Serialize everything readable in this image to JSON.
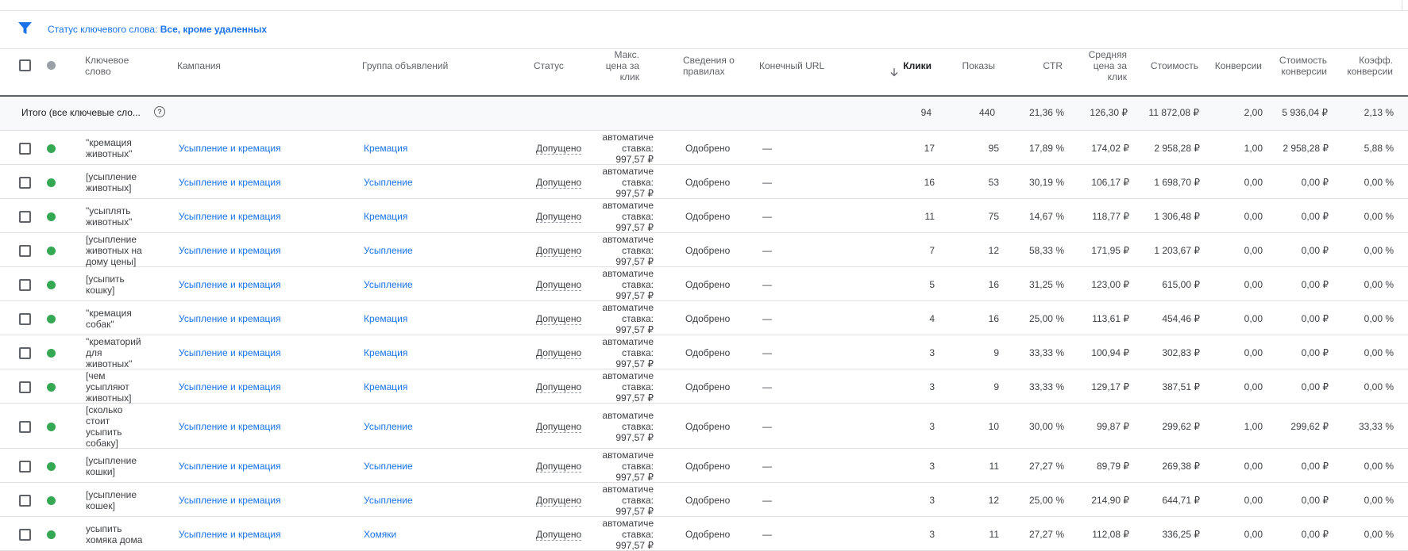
{
  "filter": {
    "label": "Статус ключевого слова: ",
    "value": "Все, кроме удаленных"
  },
  "columns": {
    "keyword": [
      "Ключевое",
      "слово"
    ],
    "campaign": "Кампания",
    "adgroup": "Группа объявлений",
    "status": "Статус",
    "maxcpc": [
      "Макс.",
      "цена за",
      "клик"
    ],
    "policy": [
      "Сведения о",
      "правилах"
    ],
    "final_url": "Конечный URL",
    "clicks": "Клики",
    "impressions": "Показы",
    "ctr": "CTR",
    "avgcpc": [
      "Средняя",
      "цена за",
      "клик"
    ],
    "cost": "Стоимость",
    "conversions": "Конверсии",
    "cost_conv": [
      "Стоимость",
      "конверсии"
    ],
    "conv_rate": [
      "Коэфф.",
      "конверсии"
    ]
  },
  "total": {
    "label": "Итого (все ключевые сло...",
    "help": "?",
    "clicks": "94",
    "impressions": "440",
    "ctr": "21,36 %",
    "avgcpc": "126,30 ₽",
    "cost": "11 872,08 ₽",
    "conversions": "2,00",
    "cost_conv": "5 936,04 ₽",
    "conv_rate": "2,13 %"
  },
  "rows": [
    {
      "keyword": [
        "\"кремация",
        "животных\""
      ],
      "campaign": "Усыпление и кремация",
      "adgroup": "Кремация",
      "status": "Допущено",
      "bid": [
        "автоматиче",
        "ставка:",
        "997,57 ₽"
      ],
      "policy": "Одобрено",
      "url": "—",
      "clicks": "17",
      "impressions": "95",
      "ctr": "17,89 %",
      "avgcpc": "174,02 ₽",
      "cost": "2 958,28 ₽",
      "conversions": "1,00",
      "cost_conv": "2 958,28 ₽",
      "conv_rate": "5,88 %"
    },
    {
      "keyword": [
        "[усыпление",
        "животных]"
      ],
      "campaign": "Усыпление и кремация",
      "adgroup": "Усыпление",
      "status": "Допущено",
      "bid": [
        "автоматиче",
        "ставка:",
        "997,57 ₽"
      ],
      "policy": "Одобрено",
      "url": "—",
      "clicks": "16",
      "impressions": "53",
      "ctr": "30,19 %",
      "avgcpc": "106,17 ₽",
      "cost": "1 698,70 ₽",
      "conversions": "0,00",
      "cost_conv": "0,00 ₽",
      "conv_rate": "0,00 %"
    },
    {
      "keyword": [
        "\"усыплять",
        "животных\""
      ],
      "campaign": "Усыпление и кремация",
      "adgroup": "Кремация",
      "status": "Допущено",
      "bid": [
        "автоматиче",
        "ставка:",
        "997,57 ₽"
      ],
      "policy": "Одобрено",
      "url": "—",
      "clicks": "11",
      "impressions": "75",
      "ctr": "14,67 %",
      "avgcpc": "118,77 ₽",
      "cost": "1 306,48 ₽",
      "conversions": "0,00",
      "cost_conv": "0,00 ₽",
      "conv_rate": "0,00 %"
    },
    {
      "keyword": [
        "[усыпление",
        "животных на",
        "дому цены]"
      ],
      "campaign": "Усыпление и кремация",
      "adgroup": "Усыпление",
      "status": "Допущено",
      "bid": [
        "автоматиче",
        "ставка:",
        "997,57 ₽"
      ],
      "policy": "Одобрено",
      "url": "—",
      "clicks": "7",
      "impressions": "12",
      "ctr": "58,33 %",
      "avgcpc": "171,95 ₽",
      "cost": "1 203,67 ₽",
      "conversions": "0,00",
      "cost_conv": "0,00 ₽",
      "conv_rate": "0,00 %"
    },
    {
      "keyword": [
        "[усыпить",
        "кошку]"
      ],
      "campaign": "Усыпление и кремация",
      "adgroup": "Усыпление",
      "status": "Допущено",
      "bid": [
        "автоматиче",
        "ставка:",
        "997,57 ₽"
      ],
      "policy": "Одобрено",
      "url": "—",
      "clicks": "5",
      "impressions": "16",
      "ctr": "31,25 %",
      "avgcpc": "123,00 ₽",
      "cost": "615,00 ₽",
      "conversions": "0,00",
      "cost_conv": "0,00 ₽",
      "conv_rate": "0,00 %"
    },
    {
      "keyword": [
        "\"кремация",
        "собак\""
      ],
      "campaign": "Усыпление и кремация",
      "adgroup": "Кремация",
      "status": "Допущено",
      "bid": [
        "автоматиче",
        "ставка:",
        "997,57 ₽"
      ],
      "policy": "Одобрено",
      "url": "—",
      "clicks": "4",
      "impressions": "16",
      "ctr": "25,00 %",
      "avgcpc": "113,61 ₽",
      "cost": "454,46 ₽",
      "conversions": "0,00",
      "cost_conv": "0,00 ₽",
      "conv_rate": "0,00 %"
    },
    {
      "keyword": [
        "\"крематорий",
        "для",
        "животных\""
      ],
      "campaign": "Усыпление и кремация",
      "adgroup": "Кремация",
      "status": "Допущено",
      "bid": [
        "автоматиче",
        "ставка:",
        "997,57 ₽"
      ],
      "policy": "Одобрено",
      "url": "—",
      "clicks": "3",
      "impressions": "9",
      "ctr": "33,33 %",
      "avgcpc": "100,94 ₽",
      "cost": "302,83 ₽",
      "conversions": "0,00",
      "cost_conv": "0,00 ₽",
      "conv_rate": "0,00 %"
    },
    {
      "keyword": [
        "[чем",
        "усыпляют",
        "животных]"
      ],
      "campaign": "Усыпление и кремация",
      "adgroup": "Кремация",
      "status": "Допущено",
      "bid": [
        "автоматиче",
        "ставка:",
        "997,57 ₽"
      ],
      "policy": "Одобрено",
      "url": "—",
      "clicks": "3",
      "impressions": "9",
      "ctr": "33,33 %",
      "avgcpc": "129,17 ₽",
      "cost": "387,51 ₽",
      "conversions": "0,00",
      "cost_conv": "0,00 ₽",
      "conv_rate": "0,00 %"
    },
    {
      "keyword": [
        "[сколько",
        "стоит",
        "усыпить",
        "собаку]"
      ],
      "campaign": "Усыпление и кремация",
      "adgroup": "Усыпление",
      "status": "Допущено",
      "bid": [
        "автоматиче",
        "ставка:",
        "997,57 ₽"
      ],
      "policy": "Одобрено",
      "url": "—",
      "clicks": "3",
      "impressions": "10",
      "ctr": "30,00 %",
      "avgcpc": "99,87 ₽",
      "cost": "299,62 ₽",
      "conversions": "1,00",
      "cost_conv": "299,62 ₽",
      "conv_rate": "33,33 %"
    },
    {
      "keyword": [
        "[усыпление",
        "кошки]"
      ],
      "campaign": "Усыпление и кремация",
      "adgroup": "Усыпление",
      "status": "Допущено",
      "bid": [
        "автоматиче",
        "ставка:",
        "997,57 ₽"
      ],
      "policy": "Одобрено",
      "url": "—",
      "clicks": "3",
      "impressions": "11",
      "ctr": "27,27 %",
      "avgcpc": "89,79 ₽",
      "cost": "269,38 ₽",
      "conversions": "0,00",
      "cost_conv": "0,00 ₽",
      "conv_rate": "0,00 %"
    },
    {
      "keyword": [
        "[усыпление",
        "кошек]"
      ],
      "campaign": "Усыпление и кремация",
      "adgroup": "Усыпление",
      "status": "Допущено",
      "bid": [
        "автоматиче",
        "ставка:",
        "997,57 ₽"
      ],
      "policy": "Одобрено",
      "url": "—",
      "clicks": "3",
      "impressions": "12",
      "ctr": "25,00 %",
      "avgcpc": "214,90 ₽",
      "cost": "644,71 ₽",
      "conversions": "0,00",
      "cost_conv": "0,00 ₽",
      "conv_rate": "0,00 %"
    },
    {
      "keyword": [
        "усыпить",
        "хомяка дома"
      ],
      "campaign": "Усыпление и кремация",
      "adgroup": "Хомяки",
      "status": "Допущено",
      "bid": [
        "автоматиче",
        "ставка:",
        "997,57 ₽"
      ],
      "policy": "Одобрено",
      "url": "—",
      "clicks": "3",
      "impressions": "11",
      "ctr": "27,27 %",
      "avgcpc": "112,08 ₽",
      "cost": "336,25 ₽",
      "conversions": "0,00",
      "cost_conv": "0,00 ₽",
      "conv_rate": "0,00 %"
    }
  ]
}
